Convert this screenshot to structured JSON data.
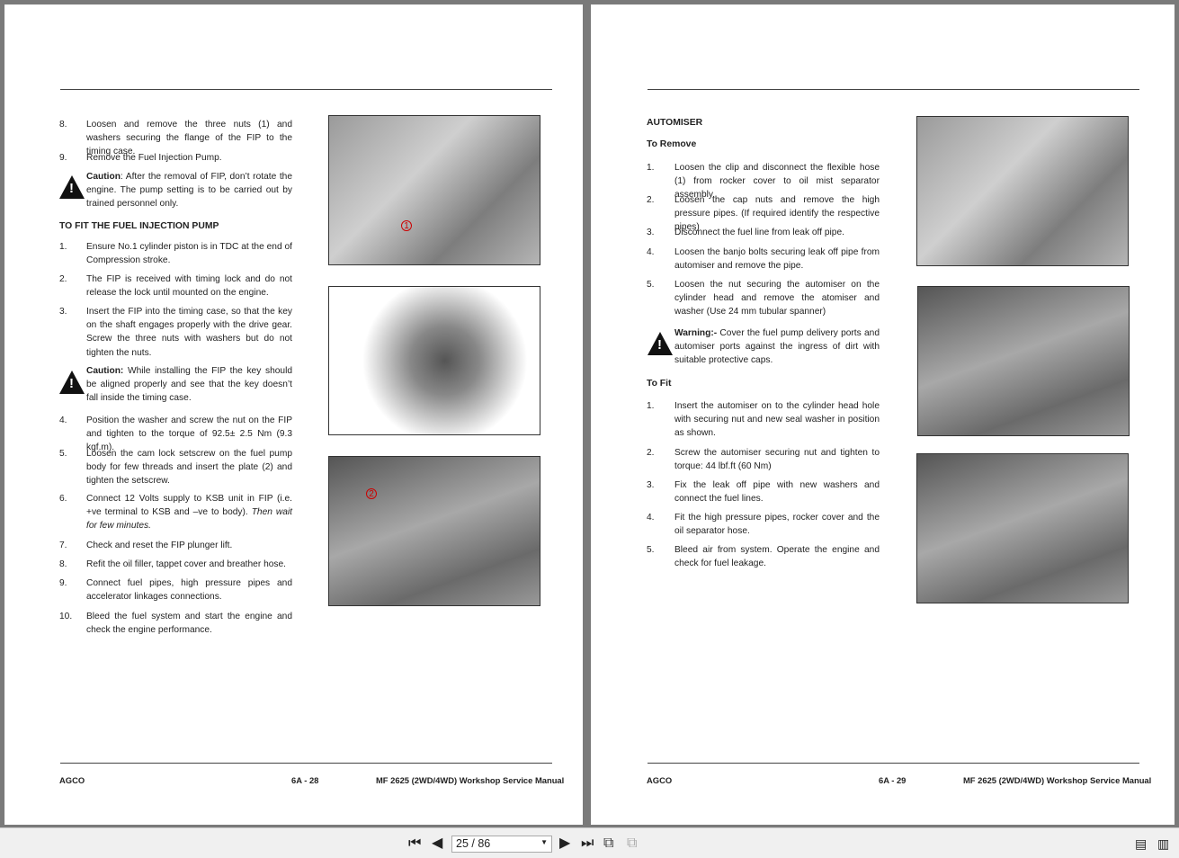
{
  "left_page": {
    "items": [
      {
        "num": "8.",
        "text": "Loosen and remove the three nuts (1) and washers securing the flange of the FIP to the timing case."
      },
      {
        "num": "9.",
        "text": "Remove the Fuel Injection Pump."
      },
      {
        "num": "",
        "bold": "Caution",
        "text": ": After the removal of FIP, don’t rotate the engine. The pump setting is to be carried out by trained personnel only."
      },
      {
        "num": "1.",
        "text": "Ensure No.1 cylinder piston is in TDC at the end of Compression stroke."
      },
      {
        "num": "2.",
        "text": "The FIP is received with timing lock and do not release the lock until mounted on the engine."
      },
      {
        "num": "3.",
        "text": "Insert the FIP into the timing case, so that the key on the shaft engages properly with the drive gear. Screw the three nuts with washers but do not tighten the nuts."
      },
      {
        "num": "",
        "bold": "Caution:",
        "text": " While installing the FIP the key should be aligned properly and see that the key doesn’t fall inside the timing case."
      },
      {
        "num": "4.",
        "text": "Position the washer and screw the nut on the FIP and tighten to the torque of 92.5± 2.5 Nm (9.3 kgf.m)."
      },
      {
        "num": "5.",
        "text": "Loosen the cam lock setscrew on the fuel pump body for few threads and insert the plate (2) and tighten the setscrew."
      },
      {
        "num": "6.",
        "text": "Connect 12 Volts supply to KSB unit in FIP (i.e. +ve terminal to KSB and –ve to body). ",
        "italic": "Then wait for few minutes."
      },
      {
        "num": "7.",
        "text": "Check and reset the FIP plunger lift."
      },
      {
        "num": "8.",
        "text": "Refit the oil filler, tappet cover and breather hose."
      },
      {
        "num": "9.",
        "text": "Connect fuel pipes, high pressure pipes and accelerator linkages connections."
      },
      {
        "num": "10.",
        "text": "Bleed the fuel system and start the engine and check the engine performance."
      }
    ],
    "heading": "TO FIT THE FUEL INJECTION PUMP",
    "markers": [
      "1",
      "2"
    ],
    "footer": {
      "left": "AGCO",
      "center": "6A - 28",
      "right": "MF 2625 (2WD/4WD) Workshop Service Manual"
    }
  },
  "right_page": {
    "title": "AUTOMISER",
    "sub_remove": "To Remove",
    "sub_fit": "To Fit",
    "items": [
      {
        "num": "1.",
        "text": "Loosen the clip and disconnect the flexible hose (1) from rocker cover to oil mist separator assembly."
      },
      {
        "num": "2.",
        "text": "Loosen the cap nuts and remove the high pressure pipes. (If required identify the respective pipes)"
      },
      {
        "num": "3.",
        "text": " Disconnect the fuel line from leak off pipe."
      },
      {
        "num": "4.",
        "text": " Loosen the banjo bolts securing leak off pipe from automiser and remove the pipe."
      },
      {
        "num": "5.",
        "text": "Loosen the nut securing the automiser on the cylinder head and remove the atomiser and washer (Use 24 mm tubular spanner)"
      },
      {
        "num": "",
        "bold": "Warning:-",
        "text": " Cover the fuel pump delivery ports and automiser ports against the ingress of dirt with suitable protective caps."
      },
      {
        "num": "1.",
        "text": "Insert the automiser on to the cylinder head hole with securing nut and new seal washer in position as shown."
      },
      {
        "num": "2.",
        "text": "Screw the automiser securing nut and tighten to torque: 44 lbf.ft (60 Nm)"
      },
      {
        "num": "3.",
        "text": "Fix the leak off pipe with new washers and connect the fuel lines."
      },
      {
        "num": "4.",
        "text": "Fit the high pressure pipes, rocker cover and the oil separator hose."
      },
      {
        "num": "5.",
        "text": "Bleed air from system. Operate the engine and check for fuel leakage."
      }
    ],
    "footer": {
      "left": "AGCO",
      "center": "6A - 29",
      "right": "MF 2625 (2WD/4WD) Workshop Service Manual"
    }
  },
  "toolbar": {
    "page_value": "25 / 86"
  }
}
